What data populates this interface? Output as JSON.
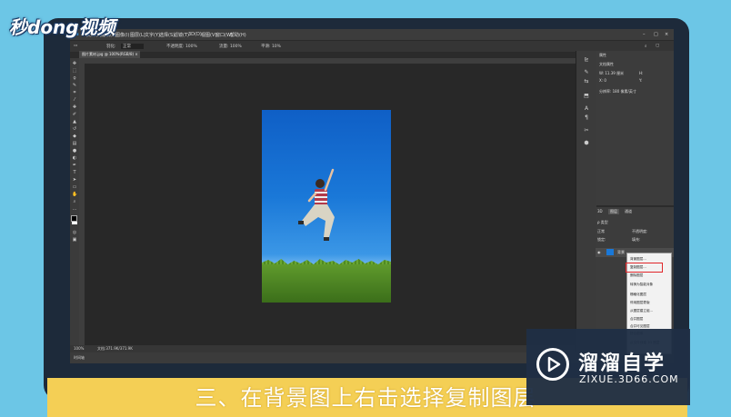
{
  "logo": {
    "text": "秒dong视频"
  },
  "menu": {
    "items": [
      "文件(F)",
      "编辑(E)",
      "图像(I)",
      "图层(L)",
      "文字(Y)",
      "选择(S)",
      "滤镜(T)",
      "3D(D)",
      "视图(V)",
      "窗口(W)",
      "帮助(H)"
    ]
  },
  "options": {
    "feather": "羽化:",
    "style": "正常",
    "opacity": "不透明度: 100%",
    "flow": "流量: 100%",
    "smooth": "平滑: 10%"
  },
  "document": {
    "tab": "图片素材.jpg @ 100%(RGB/8) ×",
    "status_zoom": "100%",
    "status_doc": "文档:371.9K/371.9K"
  },
  "bottom_tab": "时间轴",
  "properties": {
    "title": "属性",
    "subtitle": "文档属性",
    "w_label": "W: 11.39 厘米",
    "h_label": "H:",
    "x_label": "X: 0",
    "y_label": "Y:",
    "resolution": "分辨率: 180 像素/英寸"
  },
  "layers": {
    "tabs": [
      "3D",
      "图层",
      "通道"
    ],
    "kind": "ρ 类型",
    "blend": "正常",
    "opacity": "不透明度:",
    "lock": "锁定:",
    "fill": "填充:",
    "layer_name": "背景"
  },
  "context_menu": {
    "items": [
      "背景图层...",
      "复制图层...",
      "删除图层",
      "转换为智能对象",
      "栅格化图层",
      "停用图层蒙版",
      "从图层建立组...",
      "合并图层",
      "合并可见图层",
      "拼合图像",
      "从文件创建 3D 图层"
    ],
    "highlighted_index": 1
  },
  "caption": "三、在背景图上右击选择复制图层",
  "brand": {
    "title": "溜溜自学",
    "subtitle": "ZIXUE.3D66.COM"
  },
  "colors": {
    "caption_bg": "#f4cf55",
    "highlight": "#e0262a",
    "background": "#6cc6e6"
  }
}
